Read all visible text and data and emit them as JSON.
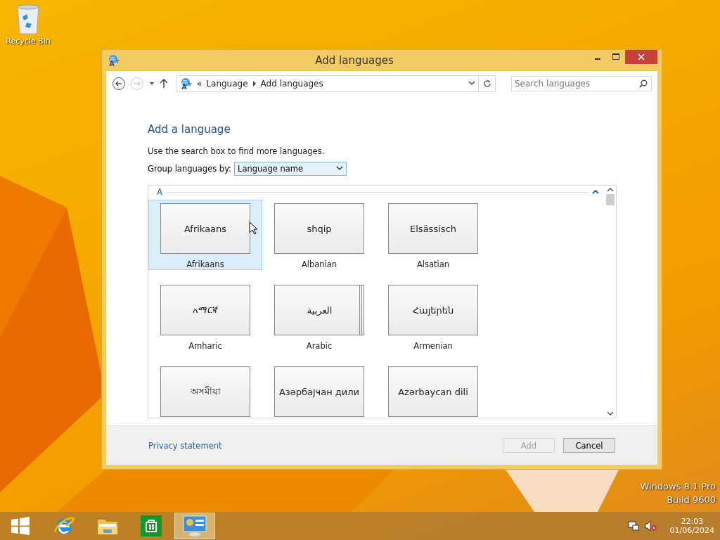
{
  "desktop": {
    "icons": [
      {
        "label": "Recycle Bin"
      }
    ],
    "watermark": [
      "Windows 8.1 Pro",
      "Build 9600"
    ]
  },
  "window": {
    "title": "Add languages",
    "address": {
      "crumbs": [
        "Language",
        "Add languages"
      ],
      "prefix": "«"
    },
    "search": {
      "placeholder": "Search languages"
    },
    "heading": "Add a language",
    "hint": "Use the search box to find more languages.",
    "group_by": {
      "label": "Group languages by:",
      "value": "Language name"
    },
    "list": {
      "group": "A",
      "items": [
        {
          "native": "Afrikaans",
          "name": "Afrikaans",
          "selected": true,
          "multiple": false
        },
        {
          "native": "shqip",
          "name": "Albanian",
          "selected": false,
          "multiple": false
        },
        {
          "native": "Elsässisch",
          "name": "Alsatian",
          "selected": false,
          "multiple": false
        },
        {
          "native": "አማርኛ",
          "name": "Amharic",
          "selected": false,
          "multiple": false
        },
        {
          "native": "العربية",
          "name": "Arabic",
          "selected": false,
          "multiple": true
        },
        {
          "native": "Հայերեն",
          "name": "Armenian",
          "selected": false,
          "multiple": false
        },
        {
          "native": "অসমীয়া",
          "selected": false,
          "multiple": false
        },
        {
          "native": "Азәрбајҹан дили",
          "selected": false,
          "multiple": false
        },
        {
          "native": "Azərbaycan dili",
          "selected": false,
          "multiple": false
        }
      ]
    },
    "footer": {
      "link": "Privacy statement",
      "buttons": [
        {
          "label": "Add",
          "disabled": true
        },
        {
          "label": "Cancel",
          "disabled": false
        }
      ]
    }
  },
  "taskbar": {
    "apps": [
      {
        "kind": "start",
        "selected": false
      },
      {
        "kind": "browser",
        "selected": false
      },
      {
        "kind": "folder",
        "selected": false
      },
      {
        "kind": "store",
        "selected": false
      },
      {
        "kind": "control",
        "selected": true
      }
    ],
    "time": "22:03",
    "date": "01/06/2024"
  }
}
